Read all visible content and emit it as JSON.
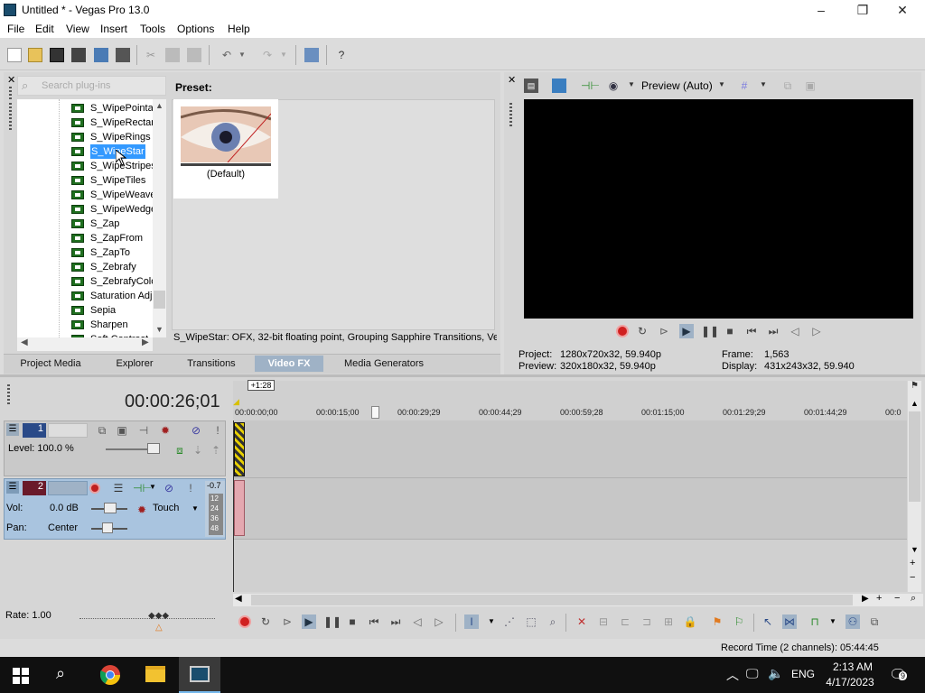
{
  "window": {
    "title": "Untitled * - Vegas Pro 13.0",
    "minimize": "–",
    "maximize": "❐",
    "close": "✕"
  },
  "menu": [
    "File",
    "Edit",
    "View",
    "Insert",
    "Tools",
    "Options",
    "Help"
  ],
  "plugins": {
    "search_placeholder": "Search plug-ins",
    "items": [
      "S_WipePointalize",
      "S_WipeRectangle",
      "S_WipeRings",
      "S_WipeStar",
      "S_WipeStripes",
      "S_WipeTiles",
      "S_WipeWeave",
      "S_WipeWedge",
      "S_Zap",
      "S_ZapFrom",
      "S_ZapTo",
      "S_Zebrafy",
      "S_ZebrafyColor",
      "Saturation Adjust",
      "Sepia",
      "Sharpen",
      "Soft Contrast"
    ],
    "selected_index": 3,
    "preset_label": "Preset:",
    "preset_name": "(Default)",
    "status": "S_WipeStar: OFX, 32-bit floating point, Grouping  Sapphire Transitions, Ve"
  },
  "tabs": [
    "Project Media",
    "Explorer",
    "Transitions",
    "Video FX",
    "Media Generators"
  ],
  "active_tab": "Video FX",
  "preview": {
    "mode": "Preview (Auto)",
    "project_label": "Project:",
    "project_value": "1280x720x32, 59.940p",
    "preview_label": "Preview:",
    "preview_value": "320x180x32, 59.940p",
    "frame_label": "Frame:",
    "frame_value": "1,563",
    "display_label": "Display:",
    "display_value": "431x243x32, 59.940"
  },
  "timeline": {
    "timecode": "00:00:26;01",
    "marker": "+1:28",
    "ruler": [
      "00:00:00;00",
      "00:00:15;00",
      "00:00:29;29",
      "00:00:44;29",
      "00:00:59;28",
      "00:01:15;00",
      "00:01:29;29",
      "00:01:44;29",
      "00:0"
    ],
    "track1_number": "1",
    "track1_level": "Level: 100.0 %",
    "track2_number": "2",
    "track2_vol_label": "Vol:",
    "track2_vol_value": "0.0 dB",
    "track2_pan_label": "Pan:",
    "track2_pan_value": "Center",
    "track2_touch": "Touch",
    "track2_meter_top": "-0.7",
    "track2_meter_ticks": [
      "12",
      "24",
      "36",
      "48"
    ],
    "rate": "Rate: 1.00",
    "record_time": "Record Time (2 channels): 05:44:45"
  },
  "taskbar": {
    "lang": "ENG",
    "time": "2:13 AM",
    "date": "4/17/2023",
    "notif_count": "9"
  },
  "colors": {
    "accent": "#3399ff",
    "tab_active": "#9fb2c6",
    "track_panel": "#a9c4df",
    "record": "#d02020"
  }
}
